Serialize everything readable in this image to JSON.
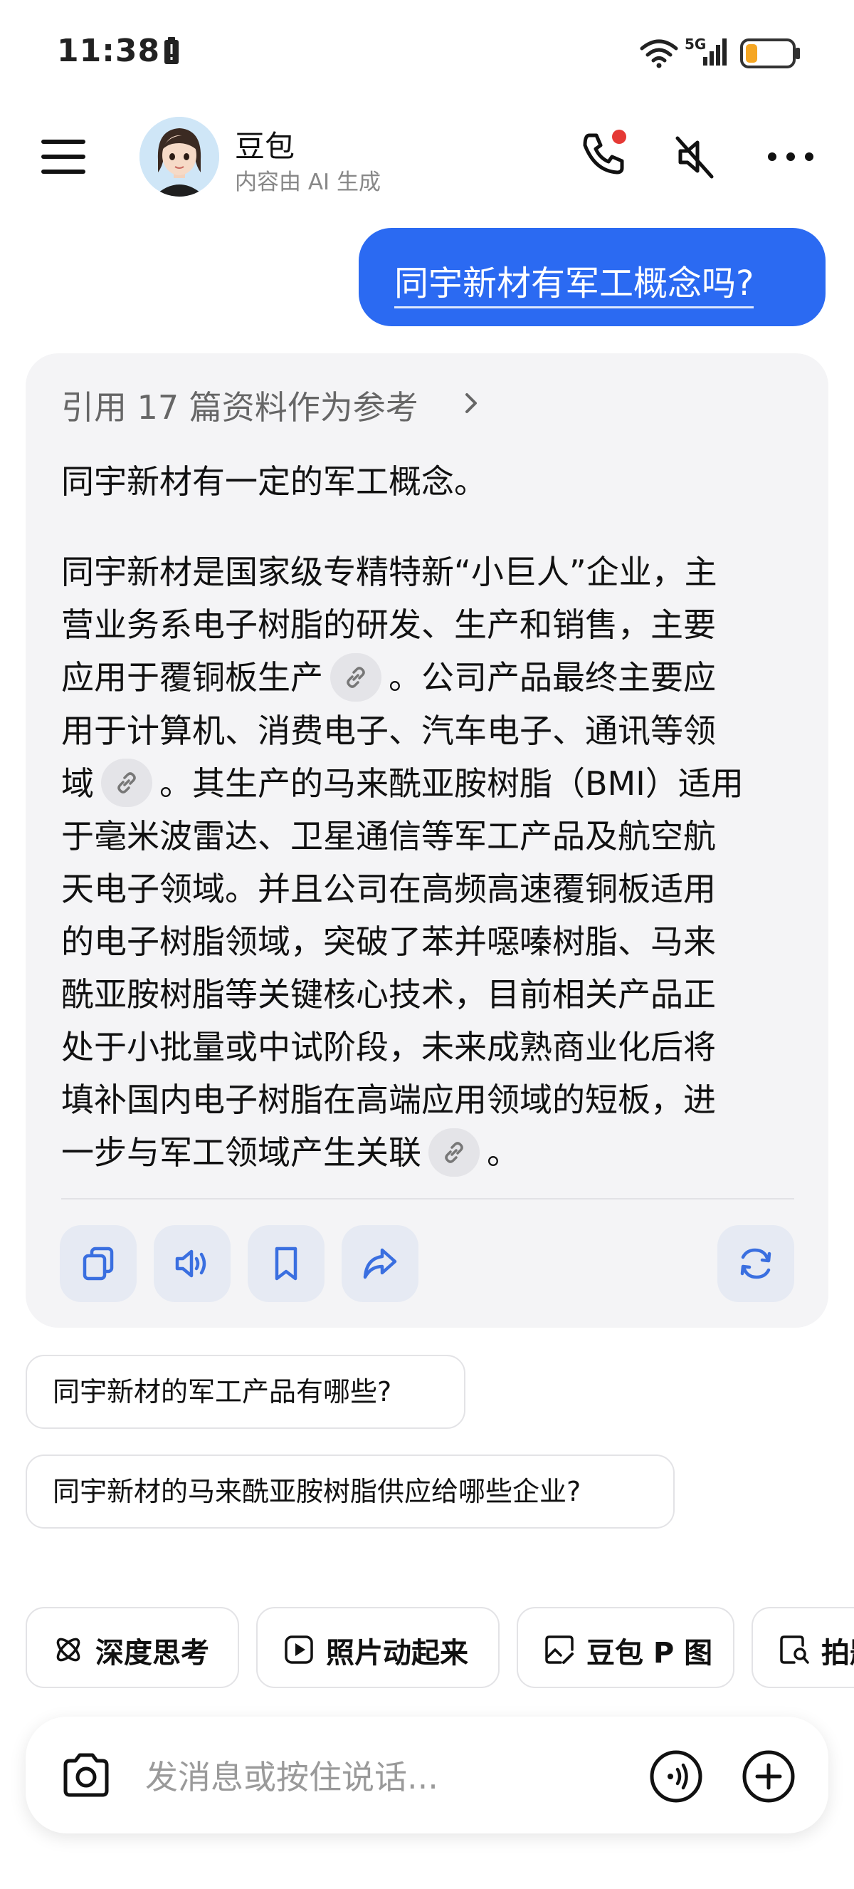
{
  "status_bar": {
    "time": "11:38",
    "network": "5G",
    "battery_level": 0.25
  },
  "header": {
    "bot_name": "豆包",
    "bot_subtitle": "内容由 AI 生成",
    "call_badge_color": "#e53935"
  },
  "user_message": {
    "text": "同宇新材有军工概念吗?"
  },
  "answer": {
    "references": "引用 17 篇资料作为参考",
    "lead": "同宇新材有一定的军工概念。",
    "lines": [
      "同宇新材是国家级专精特新“小巨人”企业，主",
      "营业务系电子树脂的研发、生产和销售，主要",
      "应用于覆铜板生产",
      "。公司产品最终主要应",
      "用于计算机、消费电子、汽车电子、通讯等领",
      "域",
      "。其生产的马来酰亚胺树脂（BMI）适用",
      "于毫米波雷达、卫星通信等军工产品及航空航",
      "天电子领域。并且公司在高频高速覆铜板适用",
      "的电子树脂领域，突破了苯并噁嗪树脂、马来",
      "酰亚胺树脂等关键核心技术，目前相关产品正",
      "处于小批量或中试阶段，未来成熟商业化后将",
      "填补国内电子树脂在高端应用领域的短板，进",
      "一步与军工领域产生关联",
      "。"
    ]
  },
  "suggestions": [
    "同宇新材的军工产品有哪些?",
    "同宇新材的马来酰亚胺树脂供应给哪些企业?"
  ],
  "tools": [
    {
      "label": "深度思考",
      "icon": "atom-icon"
    },
    {
      "label": "照片动起来",
      "icon": "play-square-icon"
    },
    {
      "label": "豆包 P 图",
      "icon": "image-edit-icon"
    },
    {
      "label": "拍题答疑",
      "icon": "doc-search-icon"
    }
  ],
  "input": {
    "placeholder": "发消息或按住说话..."
  },
  "colors": {
    "accent": "#2b6af2",
    "card_bg": "#f4f4f6",
    "action_icon": "#3a6fe0"
  }
}
